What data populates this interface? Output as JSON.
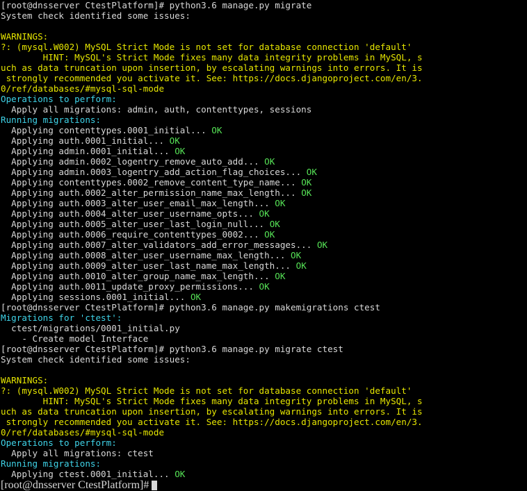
{
  "terminal": {
    "colors": {
      "background": "#000000",
      "default": "#d8d8d8",
      "warning": "#e6e600",
      "info": "#3fd3e8",
      "ok": "#56e356"
    },
    "lines": [
      [
        {
          "t": "[root@dnsserver CtestPlatform]# python3.6 manage.py migrate",
          "c": "w"
        }
      ],
      [
        {
          "t": "System check identified some issues:",
          "c": "w"
        }
      ],
      [
        {
          "t": "",
          "c": "w"
        }
      ],
      [
        {
          "t": "WARNINGS:",
          "c": "y"
        }
      ],
      [
        {
          "t": "?: (mysql.W002) MySQL Strict Mode is not set for database connection 'default'",
          "c": "y"
        }
      ],
      [
        {
          "t": "        HINT: MySQL's Strict Mode fixes many data integrity problems in MySQL, s",
          "c": "y"
        }
      ],
      [
        {
          "t": "uch as data truncation upon insertion, by escalating warnings into errors. It is",
          "c": "y"
        }
      ],
      [
        {
          "t": " strongly recommended you activate it. See: https://docs.djangoproject.com/en/3.",
          "c": "y"
        }
      ],
      [
        {
          "t": "0/ref/databases/#mysql-sql-mode",
          "c": "y"
        }
      ],
      [
        {
          "t": "Operations to perform:",
          "c": "c"
        }
      ],
      [
        {
          "t": "  Apply all migrations: admin, auth, contenttypes, sessions",
          "c": "w"
        }
      ],
      [
        {
          "t": "Running migrations:",
          "c": "c"
        }
      ],
      [
        {
          "t": "  Applying contenttypes.0001_initial... ",
          "c": "w"
        },
        {
          "t": "OK",
          "c": "g"
        }
      ],
      [
        {
          "t": "  Applying auth.0001_initial... ",
          "c": "w"
        },
        {
          "t": "OK",
          "c": "g"
        }
      ],
      [
        {
          "t": "  Applying admin.0001_initial... ",
          "c": "w"
        },
        {
          "t": "OK",
          "c": "g"
        }
      ],
      [
        {
          "t": "  Applying admin.0002_logentry_remove_auto_add... ",
          "c": "w"
        },
        {
          "t": "OK",
          "c": "g"
        }
      ],
      [
        {
          "t": "  Applying admin.0003_logentry_add_action_flag_choices... ",
          "c": "w"
        },
        {
          "t": "OK",
          "c": "g"
        }
      ],
      [
        {
          "t": "  Applying contenttypes.0002_remove_content_type_name... ",
          "c": "w"
        },
        {
          "t": "OK",
          "c": "g"
        }
      ],
      [
        {
          "t": "  Applying auth.0002_alter_permission_name_max_length... ",
          "c": "w"
        },
        {
          "t": "OK",
          "c": "g"
        }
      ],
      [
        {
          "t": "  Applying auth.0003_alter_user_email_max_length... ",
          "c": "w"
        },
        {
          "t": "OK",
          "c": "g"
        }
      ],
      [
        {
          "t": "  Applying auth.0004_alter_user_username_opts... ",
          "c": "w"
        },
        {
          "t": "OK",
          "c": "g"
        }
      ],
      [
        {
          "t": "  Applying auth.0005_alter_user_last_login_null... ",
          "c": "w"
        },
        {
          "t": "OK",
          "c": "g"
        }
      ],
      [
        {
          "t": "  Applying auth.0006_require_contenttypes_0002... ",
          "c": "w"
        },
        {
          "t": "OK",
          "c": "g"
        }
      ],
      [
        {
          "t": "  Applying auth.0007_alter_validators_add_error_messages... ",
          "c": "w"
        },
        {
          "t": "OK",
          "c": "g"
        }
      ],
      [
        {
          "t": "  Applying auth.0008_alter_user_username_max_length... ",
          "c": "w"
        },
        {
          "t": "OK",
          "c": "g"
        }
      ],
      [
        {
          "t": "  Applying auth.0009_alter_user_last_name_max_length... ",
          "c": "w"
        },
        {
          "t": "OK",
          "c": "g"
        }
      ],
      [
        {
          "t": "  Applying auth.0010_alter_group_name_max_length... ",
          "c": "w"
        },
        {
          "t": "OK",
          "c": "g"
        }
      ],
      [
        {
          "t": "  Applying auth.0011_update_proxy_permissions... ",
          "c": "w"
        },
        {
          "t": "OK",
          "c": "g"
        }
      ],
      [
        {
          "t": "  Applying sessions.0001_initial... ",
          "c": "w"
        },
        {
          "t": "OK",
          "c": "g"
        }
      ],
      [
        {
          "t": "[root@dnsserver CtestPlatform]# python3.6 manage.py makemigrations ctest",
          "c": "w"
        }
      ],
      [
        {
          "t": "Migrations for 'ctest':",
          "c": "c"
        }
      ],
      [
        {
          "t": "  ctest/migrations/0001_initial.py",
          "c": "w"
        }
      ],
      [
        {
          "t": "    - Create model Interface",
          "c": "w"
        }
      ],
      [
        {
          "t": "[root@dnsserver CtestPlatform]# python3.6 manage.py migrate ctest",
          "c": "w"
        }
      ],
      [
        {
          "t": "System check identified some issues:",
          "c": "w"
        }
      ],
      [
        {
          "t": "",
          "c": "w"
        }
      ],
      [
        {
          "t": "WARNINGS:",
          "c": "y"
        }
      ],
      [
        {
          "t": "?: (mysql.W002) MySQL Strict Mode is not set for database connection 'default'",
          "c": "y"
        }
      ],
      [
        {
          "t": "        HINT: MySQL's Strict Mode fixes many data integrity problems in MySQL, s",
          "c": "y"
        }
      ],
      [
        {
          "t": "uch as data truncation upon insertion, by escalating warnings into errors. It is",
          "c": "y"
        }
      ],
      [
        {
          "t": " strongly recommended you activate it. See: https://docs.djangoproject.com/en/3.",
          "c": "y"
        }
      ],
      [
        {
          "t": "0/ref/databases/#mysql-sql-mode",
          "c": "y"
        }
      ],
      [
        {
          "t": "Operations to perform:",
          "c": "c"
        }
      ],
      [
        {
          "t": "  Apply all migrations: ctest",
          "c": "w"
        }
      ],
      [
        {
          "t": "Running migrations:",
          "c": "c"
        }
      ],
      [
        {
          "t": "  Applying ctest.0001_initial... ",
          "c": "w"
        },
        {
          "t": "OK",
          "c": "g"
        }
      ]
    ],
    "prompt": "[root@dnsserver CtestPlatform]# "
  }
}
